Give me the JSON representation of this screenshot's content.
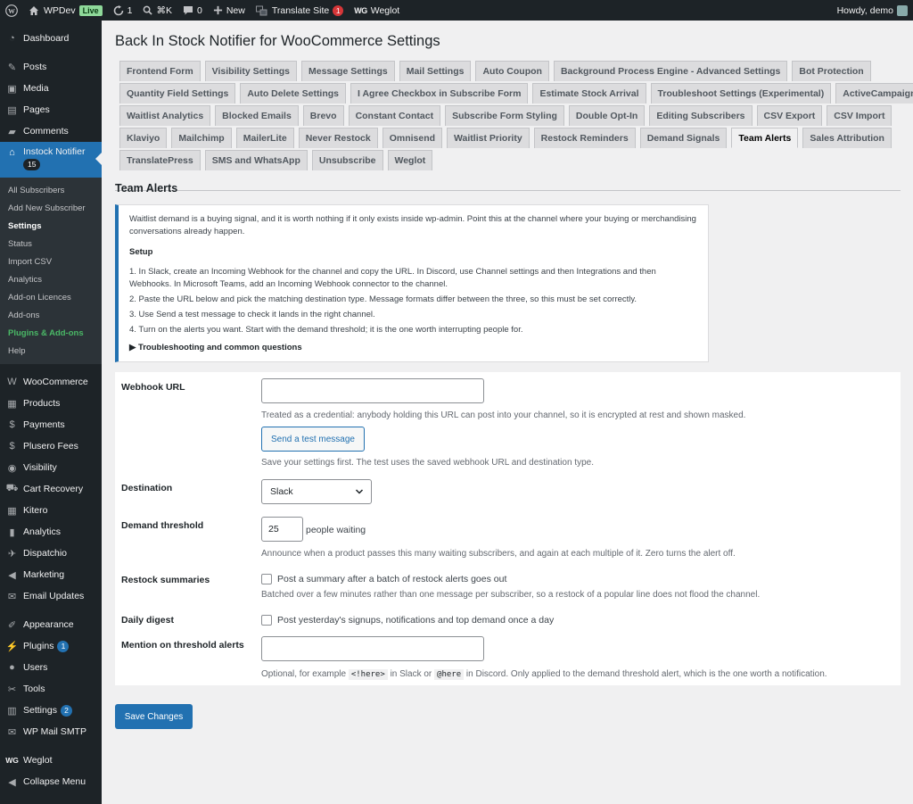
{
  "admin_bar": {
    "site_name": "WPDev",
    "live_badge": "Live",
    "updates_count": "1",
    "shortcut": "⌘K",
    "comments_count": "0",
    "new_label": "New",
    "translate_label": "Translate Site",
    "translate_count": "1",
    "weglot_mark": "WG",
    "weglot_label": "Weglot",
    "howdy": "Howdy, demo"
  },
  "sidebar": {
    "dashboard": "Dashboard",
    "posts": "Posts",
    "media": "Media",
    "pages": "Pages",
    "comments": "Comments",
    "instock": "Instock Notifier",
    "instock_count": "15",
    "submenu": [
      "All Subscribers",
      "Add New Subscriber",
      "Settings",
      "Status",
      "Import CSV",
      "Analytics",
      "Add-on Licences",
      "Add-ons",
      "Plugins & Add-ons",
      "Help"
    ],
    "woocommerce": "WooCommerce",
    "products": "Products",
    "payments": "Payments",
    "plusero": "Plusero Fees",
    "visibility": "Visibility",
    "cart_recovery": "Cart Recovery",
    "kitero": "Kitero",
    "analytics": "Analytics",
    "dispatchio": "Dispatchio",
    "marketing": "Marketing",
    "email_updates": "Email Updates",
    "appearance": "Appearance",
    "plugins": "Plugins",
    "plugins_count": "1",
    "users": "Users",
    "tools": "Tools",
    "settings": "Settings",
    "settings_count": "2",
    "wp_mail_smtp": "WP Mail SMTP",
    "weglot_mark": "WG",
    "weglot": "Weglot",
    "collapse": "Collapse Menu"
  },
  "page": {
    "title": "Back In Stock Notifier for WooCommerce Settings",
    "section_title": "Team Alerts"
  },
  "tabs": [
    [
      "Frontend Form",
      "Visibility Settings",
      "Message Settings",
      "Mail Settings",
      "Auto Coupon",
      "Background Process Engine - Advanced Settings",
      "Bot Protection"
    ],
    [
      "Quantity Field Settings",
      "Auto Delete Settings",
      "I Agree Checkbox in Subscribe Form",
      "Estimate Stock Arrival",
      "Troubleshoot Settings (Experimental)",
      "ActiveCampaign"
    ],
    [
      "Waitlist Analytics",
      "Blocked Emails",
      "Brevo",
      "Constant Contact",
      "Subscribe Form Styling",
      "Double Opt-In",
      "Editing Subscribers",
      "CSV Export",
      "CSV Import"
    ],
    [
      "Klaviyo",
      "Mailchimp",
      "MailerLite",
      "Never Restock",
      "Omnisend",
      "Waitlist Priority",
      "Restock Reminders",
      "Demand Signals",
      "Team Alerts",
      "Sales Attribution"
    ],
    [
      "TranslatePress",
      "SMS and WhatsApp",
      "Unsubscribe",
      "Weglot"
    ]
  ],
  "active_tab": "Team Alerts",
  "notice": {
    "intro": "Waitlist demand is a buying signal, and it is worth nothing if it only exists inside wp-admin. Point this at the channel where your buying or merchandising conversations already happen.",
    "setup_heading": "Setup",
    "steps": [
      "1. In Slack, create an Incoming Webhook for the channel and copy the URL. In Discord, use Channel settings and then Integrations and then Webhooks. In Microsoft Teams, add an Incoming Webhook connector to the channel.",
      "2. Paste the URL below and pick the matching destination type. Message formats differ between the three, so this must be set correctly.",
      "3. Use Send a test message to check it lands in the right channel.",
      "4. Turn on the alerts you want. Start with the demand threshold; it is the one worth interrupting people for."
    ],
    "details": "▶ Troubleshooting and common questions"
  },
  "form": {
    "webhook_label": "Webhook URL",
    "webhook_value": "",
    "webhook_desc": "Treated as a credential: anybody holding this URL can post into your channel, so it is encrypted at rest and shown masked.",
    "test_button": "Send a test message",
    "test_desc": "Save your settings first. The test uses the saved webhook URL and destination type.",
    "destination_label": "Destination",
    "destination_value": "Slack",
    "threshold_label": "Demand threshold",
    "threshold_value": "25",
    "threshold_suffix": "people waiting",
    "threshold_desc": "Announce when a product passes this many waiting subscribers, and again at each multiple of it. Zero turns the alert off.",
    "restock_label": "Restock summaries",
    "restock_checkbox": "Post a summary after a batch of restock alerts goes out",
    "restock_desc": "Batched over a few minutes rather than one message per subscriber, so a restock of a popular line does not flood the channel.",
    "digest_label": "Daily digest",
    "digest_checkbox": "Post yesterday's signups, notifications and top demand once a day",
    "mention_label": "Mention on threshold alerts",
    "mention_value": "",
    "mention_desc_1": "Optional, for example",
    "mention_code_1": "<!here>",
    "mention_desc_2": "in Slack or",
    "mention_code_2": "@here",
    "mention_desc_3": "in Discord. Only applied to the demand threshold alert, which is the one worth a notification."
  },
  "save_button": "Save Changes",
  "colors": {
    "accent": "#2271b1",
    "admin_dark": "#1d2327",
    "badge_red": "#d63638",
    "live_green": "#8fd99a"
  }
}
